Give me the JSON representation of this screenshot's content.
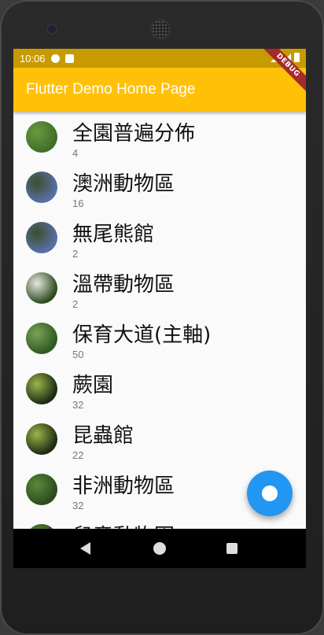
{
  "status": {
    "time": "10:06"
  },
  "appbar": {
    "title": "Flutter Demo Home Page",
    "banner": "DEBUG"
  },
  "list": [
    {
      "title": "全園普遍分佈",
      "count": "4",
      "avatar": [
        "#3f6e2a",
        "#6b9a3f"
      ]
    },
    {
      "title": "澳洲動物區",
      "count": "16",
      "avatar": [
        "#5a6fa8",
        "#3b4f2a"
      ]
    },
    {
      "title": "無尾熊館",
      "count": "2",
      "avatar": [
        "#5a6fa8",
        "#3b4f2a"
      ]
    },
    {
      "title": "溫帶動物區",
      "count": "2",
      "avatar": [
        "#2c4a1e",
        "#e8e8e0"
      ]
    },
    {
      "title": "保育大道(主軸)",
      "count": "50",
      "avatar": [
        "#2e5a22",
        "#7aa257"
      ]
    },
    {
      "title": "蕨園",
      "count": "32",
      "avatar": [
        "#1c2a12",
        "#9bb54a"
      ]
    },
    {
      "title": "昆蟲館",
      "count": "22",
      "avatar": [
        "#1c2a12",
        "#9bb54a"
      ]
    },
    {
      "title": "非洲動物區",
      "count": "32",
      "avatar": [
        "#2a4a1e",
        "#5a8a3a"
      ]
    },
    {
      "title": "兒童動物園",
      "count": "",
      "avatar": [
        "#2a4a1e",
        "#5a8a3a"
      ]
    }
  ]
}
